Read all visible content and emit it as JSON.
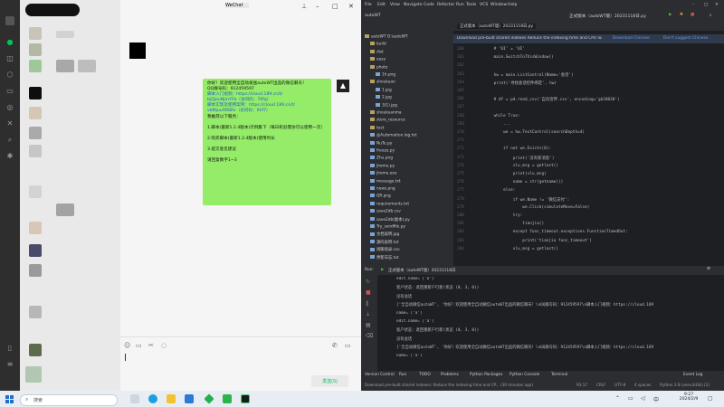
{
  "wechat": {
    "title_blur": "WeChat",
    "chat_message": {
      "lines": [
        "你好！欢迎使用全自动发送autoWT出品的微信聊天！",
        "QQ群号码：912459597",
        "脚本入门视频：https://cloud.189.cn/t/",
        "bjQjeuNjmYFb（访问码：76fq）",
        "脚本实现及使用案例：https://cloud.189.cn/t/",
        "vbMjuuAf6Bfv（访问码：0hf7）",
        "我推荐以下服务：",
        "",
        "1.脚本(最新1.2.4版本)示例集下（每日机验需仿可以使用一次）",
        "",
        "2.购买脚本(最新1.2.4版本)使用时长",
        "",
        "3.提交意见建议",
        "",
        "请回复数字1~3"
      ]
    },
    "send_label": "发送(S)"
  },
  "ide": {
    "menu": [
      "File",
      "Edit",
      "View",
      "Navigate",
      "Code",
      "Refactor",
      "Run",
      "Tools",
      "VCS",
      "Window",
      "Help"
    ],
    "project_name": "autoWT",
    "run_config": "正式版本（autoWT版）20231118日.py",
    "editor_tab": "正式版本（autoWT版）20231118日.py",
    "banner_text": "Download pre-built shared indexes  Reduce the indexing time and CPU load with pre-built Python packages shared indexes",
    "banner_actions": [
      "Download Chinese",
      "Don't suggest Chinese"
    ],
    "tree": [
      "autoWT  D:\\autoWT",
      "build",
      "dist",
      "easy",
      "photo",
      "1h.png",
      "shoukuan",
      "1.jpg",
      "2.jpg",
      "3(1).jpg",
      "shoukuanma",
      "store_resource",
      "test",
      "@Automation.log.txt",
      "NuTu.py",
      "freeze.py",
      "Zhu.png",
      "jhome.py",
      "jhome.exe",
      "message.txt",
      "news.png",
      "QR.png",
      "requirements.txt",
      "save2db.csv",
      "save2db(副本).py",
      "Try_sendfile.py",
      "文档说明.jpg",
      "源码说明.txt",
      "闲聊语录.csv",
      "更新日志.txt"
    ],
    "code": [
      "    # 'UI' = 'UI'",
      "    main.SwitchToThisWindow()",
      "",
      "    hw = main.ListControl(Name='会话')",
      "    print('寻找会话控件绑定', hw)",
      "",
      "    # df = pd.read_csv('自贡宣传.csv', encoding='gb18030')",
      "",
      "    while True:",
      "        ...",
      "        we = hw.TextControl(searchDepth=4)",
      "",
      "        if not we.Exists(0):",
      "            print('没有新消息')",
      "            vlu_msg = getlast()",
      "            print(vlu_msg)",
      "            name = str(getname())",
      "        else:",
      "            if we.Name != '微信支付':",
      "                we.Click(simulateMove=False)",
      "            try:",
      "                tianjia()",
      "            except func_timeout.exceptions.FunctionTimedOut:",
      "                print('tianjia func_timeout')",
      "            vlu_msg = getlast()"
    ],
    "run_tab_label": "正式版本（autoWT版）20231118日",
    "output": [
      "edit.name= ['a']",
      "客户状态：退回重新户行新(状态 (0, 3, 0))",
      "没有会话",
      "['全自动微信autoWT', '你好！欢迎使用全自动微信autoWT出品的微信聊天！\\nQQ群号码：912459597\\n脚本入门视频：https://cloud.189",
      "name= ['a']",
      "edit.name= ['a']",
      "客户状态：退回重新户行新(状态 (0, 3, 0))",
      "没有会话",
      "['全自动微信autoWT', '你好！欢迎使用全自动微信autoWT出品的微信聊天！\\nQQ群号码：912459597\\n脚本入门视频：https://cloud.189",
      "name= ['a']"
    ],
    "bottom_tabs": [
      "Version Control",
      "Run",
      "TODO",
      "Problems",
      "Python Packages",
      "Python Console",
      "Terminal",
      "Event Log"
    ],
    "status_left": "Download pre-built shared indexes: Reduce the indexing time and CP... (30 minutes ago)",
    "status_right": [
      "93:17",
      "CRLF",
      "UTF-8",
      "4 spaces",
      "Python 3.8 (venv3d3k) (2)"
    ]
  },
  "taskbar": {
    "search_placeholder": "搜索",
    "clock_time": "9:27",
    "clock_date": "2024/2/9"
  },
  "colors": {
    "wechat_bubble": "#95ec69",
    "wechat_send_text": "#07c160",
    "ide_bg": "#1e1f22",
    "link_blue": "#1a5fd0"
  }
}
